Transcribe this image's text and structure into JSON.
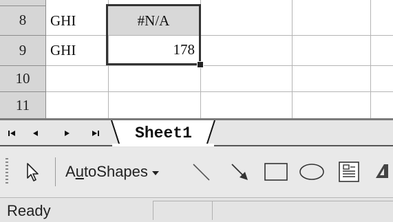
{
  "grid": {
    "rows": [
      {
        "header": "8",
        "col_a": "GHI",
        "col_b": "#N/A"
      },
      {
        "header": "9",
        "col_a": "GHI",
        "col_b": "178"
      },
      {
        "header": "10",
        "col_a": "",
        "col_b": ""
      },
      {
        "header": "11",
        "col_a": "",
        "col_b": ""
      }
    ]
  },
  "tabs": {
    "active_sheet": "Sheet1",
    "nav": [
      "first-sheet",
      "previous-sheet",
      "next-sheet",
      "last-sheet"
    ]
  },
  "toolbar": {
    "autoshapes_label_prefix": "A",
    "autoshapes_label_underlined": "u",
    "autoshapes_label_suffix": "toShapes",
    "tools": [
      "select-objects-icon",
      "line-icon",
      "arrow-icon",
      "rectangle-icon",
      "oval-icon",
      "text-box-icon",
      "wordart-icon"
    ]
  },
  "status": {
    "text": "Ready"
  },
  "colors": {
    "selected_cell_fill": "#d8d8d8",
    "row_header_fill": "#d6d6d6",
    "selection_border": "#333333"
  }
}
